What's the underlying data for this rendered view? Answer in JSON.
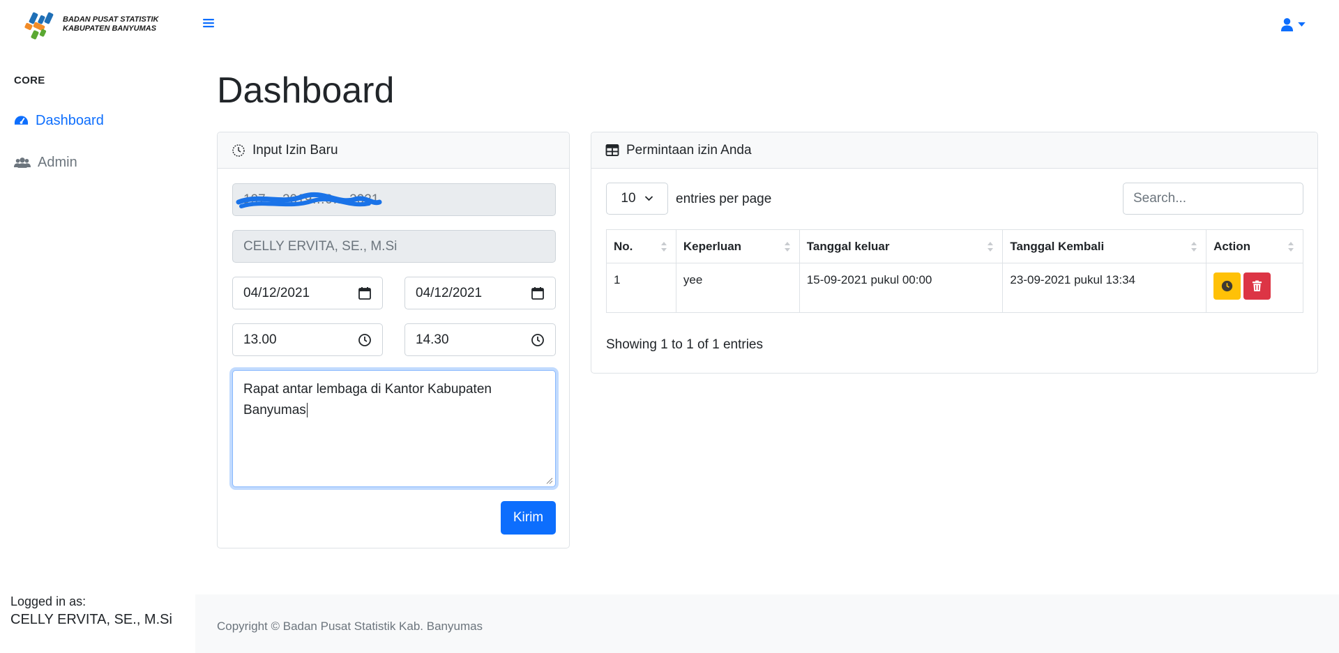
{
  "brand": {
    "line1": "BADAN PUSAT STATISTIK",
    "line2": "KABUPATEN BANYUMAS",
    "logo_colors": [
      "#1f6fb6",
      "#f28c28",
      "#5aa832"
    ]
  },
  "topnav": {
    "menu_icon": "bars-icon",
    "user_icon": "user-icon"
  },
  "sidebar": {
    "heading": "CORE",
    "items": [
      {
        "label": "Dashboard",
        "icon": "tachometer-icon",
        "active": true
      },
      {
        "label": "Admin",
        "icon": "users-icon",
        "active": false
      }
    ],
    "logged_in_label": "Logged in as:",
    "logged_in_name": "CELLY ERVITA, SE., M.Si"
  },
  "page": {
    "title": "Dashboard"
  },
  "form_card": {
    "header": "Input Izin Baru",
    "header_icon": "clock-icon",
    "nip_value": "197… 2019…0… 2021",
    "name_value": "CELLY ERVITA, SE., M.Si",
    "date_start": "04/12/2021",
    "date_end": "04/12/2021",
    "time_start": "13.00",
    "time_end": "14.30",
    "purpose": "Rapat antar lembaga di Kantor Kabupaten Banyumas",
    "submit_label": "Kirim"
  },
  "requests_card": {
    "header": "Permintaan izin Anda",
    "header_icon": "table-icon",
    "per_page": "10",
    "per_page_label": "entries per page",
    "search_placeholder": "Search...",
    "columns": [
      "No.",
      "Keperluan",
      "Tanggal keluar",
      "Tanggal Kembali",
      "Action"
    ],
    "rows": [
      {
        "no": "1",
        "keperluan": "yee",
        "keluar": "15-09-2021 pukul 00:00",
        "kembali": "23-09-2021 pukul 13:34"
      }
    ],
    "info": "Showing 1 to 1 of 1 entries"
  },
  "footer": {
    "copyright": "Copyright © Badan Pusat Statistik Kab. Banyumas"
  },
  "colors": {
    "primary": "#0d6efd",
    "warning": "#ffc107",
    "danger": "#dc3545",
    "redaction": "#1a73e8"
  }
}
